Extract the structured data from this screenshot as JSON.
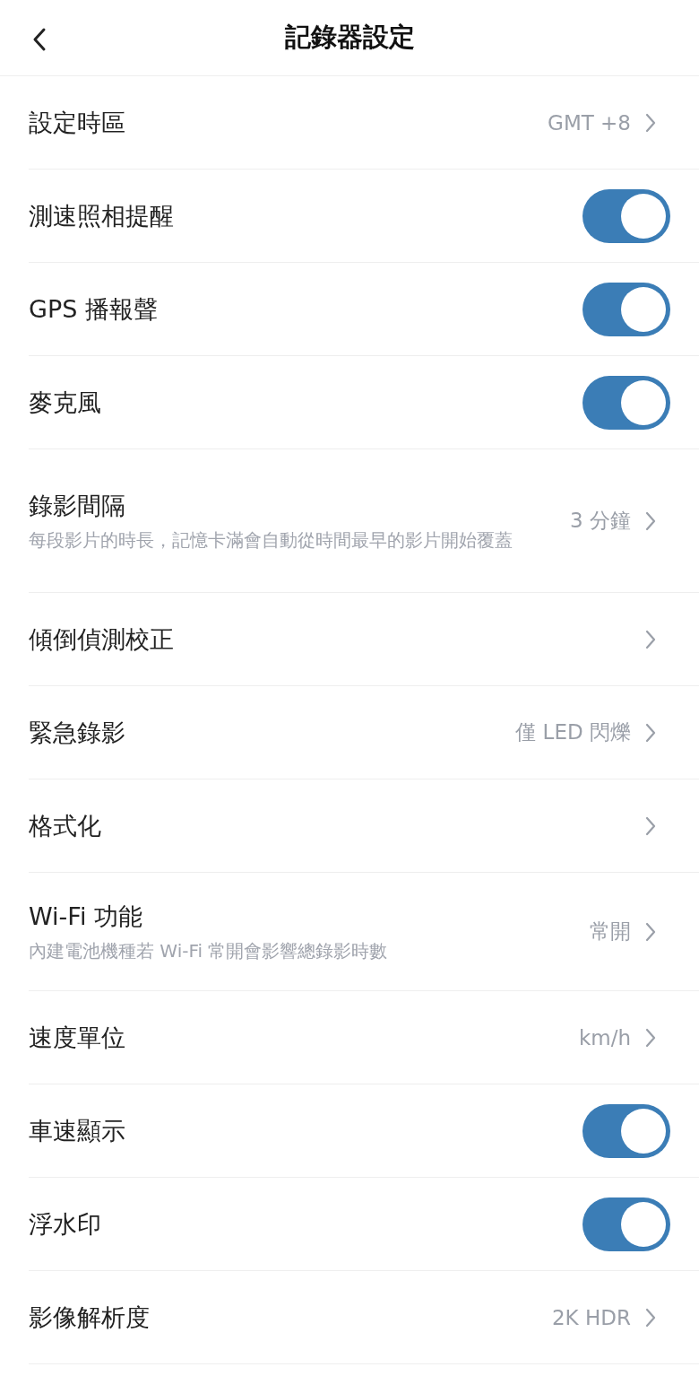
{
  "header": {
    "title": "記錄器設定"
  },
  "settings": [
    {
      "kind": "link",
      "label": "設定時區",
      "value": "GMT +8"
    },
    {
      "kind": "toggle",
      "label": "測速照相提醒",
      "on": true
    },
    {
      "kind": "toggle",
      "label": "GPS 播報聲",
      "on": true
    },
    {
      "kind": "toggle",
      "label": "麥克風",
      "on": true
    },
    {
      "kind": "link",
      "label": "錄影間隔",
      "description": "每段影片的時長，記憶卡滿會自動從時間最早的影片開始覆蓋",
      "value": "3 分鐘"
    },
    {
      "kind": "link",
      "label": "傾倒偵測校正"
    },
    {
      "kind": "link",
      "label": "緊急錄影",
      "value": "僅 LED 閃爍"
    },
    {
      "kind": "link",
      "label": "格式化"
    },
    {
      "kind": "link",
      "label": "Wi-Fi 功能",
      "description": "內建電池機種若 Wi-Fi 常開會影響總錄影時數",
      "value": "常開"
    },
    {
      "kind": "link",
      "label": "速度單位",
      "value": "km/h"
    },
    {
      "kind": "toggle",
      "label": "車速顯示",
      "on": true
    },
    {
      "kind": "toggle",
      "label": "浮水印",
      "on": true
    },
    {
      "kind": "link",
      "label": "影像解析度",
      "value": "2K HDR"
    }
  ]
}
